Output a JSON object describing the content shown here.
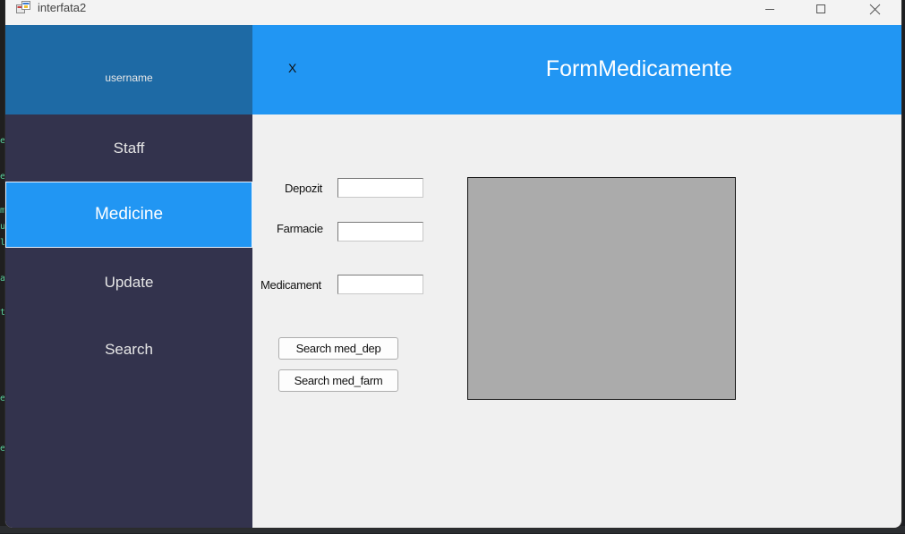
{
  "window": {
    "title": "interfata2"
  },
  "sidebar": {
    "username": "username",
    "items": [
      {
        "label": "Staff",
        "active": false
      },
      {
        "label": "Medicine",
        "active": true
      },
      {
        "label": "Update",
        "active": false
      },
      {
        "label": "Search",
        "active": false
      }
    ]
  },
  "header": {
    "close_label": "X",
    "title": "FormMedicamente"
  },
  "form": {
    "depozit_label": "Depozit",
    "depozit_value": "",
    "farmacie_label": "Farmacie",
    "farmacie_value": "",
    "medicament_label": "Medicament",
    "medicament_value": "",
    "search_med_dep_label": "Search med_dep",
    "search_med_farm_label": "Search med_farm"
  },
  "colors": {
    "sidebar": "#33334d",
    "user_panel": "#1e6aa5",
    "accent": "#2196f3",
    "grid": "#ababab"
  },
  "icons": {
    "app": "app-window-icon",
    "minimize": "minimize-icon",
    "maximize": "maximize-icon",
    "close": "close-icon"
  }
}
